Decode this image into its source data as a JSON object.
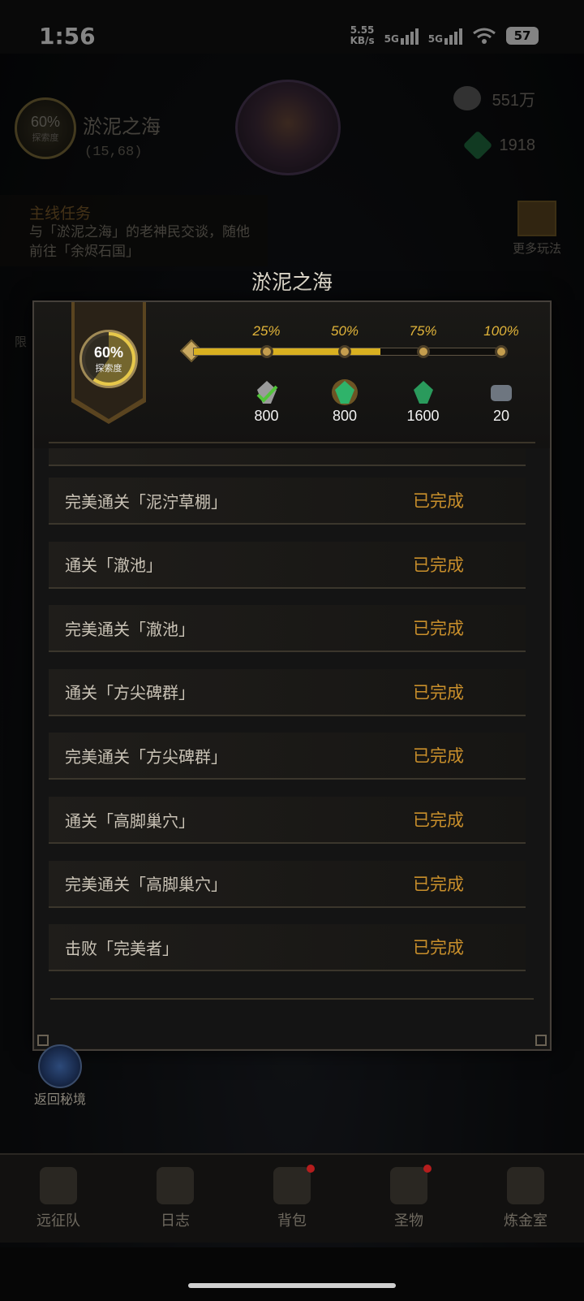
{
  "status_bar": {
    "time": "1:56",
    "net_speed": "5.55",
    "net_unit": "KB/s",
    "sim1": "5G",
    "sim2": "5G",
    "wifi_index": "6",
    "battery": "57"
  },
  "background": {
    "exploration_percent": "60%",
    "exploration_label": "探索度",
    "area_name": "淤泥之海",
    "area_coord": "(15,68)",
    "silver": "551万",
    "gems": "1918",
    "quest_title": "主线任务",
    "quest_text": "与「淤泥之海」的老神民交谈，随他前往「余烬石国」",
    "more_play": "更多玩法",
    "side_label": "限"
  },
  "dialog": {
    "title": "淤泥之海",
    "exploration_percent": "60%",
    "exploration_label": "探索度",
    "progress_fraction": 0.6,
    "milestones": [
      {
        "label": "25%",
        "amount": "800",
        "icon": "silver-crystal-icon",
        "claimed": true
      },
      {
        "label": "50%",
        "amount": "800",
        "icon": "green-gem-glowing-icon",
        "claimed": false
      },
      {
        "label": "75%",
        "amount": "1600",
        "icon": "green-gem-icon",
        "claimed": false
      },
      {
        "label": "100%",
        "amount": "20",
        "icon": "ore-icon",
        "claimed": false
      }
    ],
    "tasks": [
      {
        "name": "完美通关「泥泞草棚」",
        "status": "已完成"
      },
      {
        "name": "通关「澈池」",
        "status": "已完成"
      },
      {
        "name": "完美通关「澈池」",
        "status": "已完成"
      },
      {
        "name": "通关「方尖碑群」",
        "status": "已完成"
      },
      {
        "name": "完美通关「方尖碑群」",
        "status": "已完成"
      },
      {
        "name": "通关「高脚巢穴」",
        "status": "已完成"
      },
      {
        "name": "完美通关「高脚巢穴」",
        "status": "已完成"
      },
      {
        "name": "击败「完美者」",
        "status": "已完成"
      }
    ]
  },
  "return_button": "返回秘境",
  "bottom_nav": [
    {
      "label": "远征队",
      "icon": "helmet-icon",
      "badge": false
    },
    {
      "label": "日志",
      "icon": "scroll-icon",
      "badge": false
    },
    {
      "label": "背包",
      "icon": "bag-icon",
      "badge": true
    },
    {
      "label": "圣物",
      "icon": "chalice-icon",
      "badge": true
    },
    {
      "label": "炼金室",
      "icon": "alchemy-icon",
      "badge": false
    }
  ],
  "colors": {
    "accent_gold": "#e1b43a",
    "status_done": "#c98f2b",
    "progress_fill": "#d9b020"
  }
}
